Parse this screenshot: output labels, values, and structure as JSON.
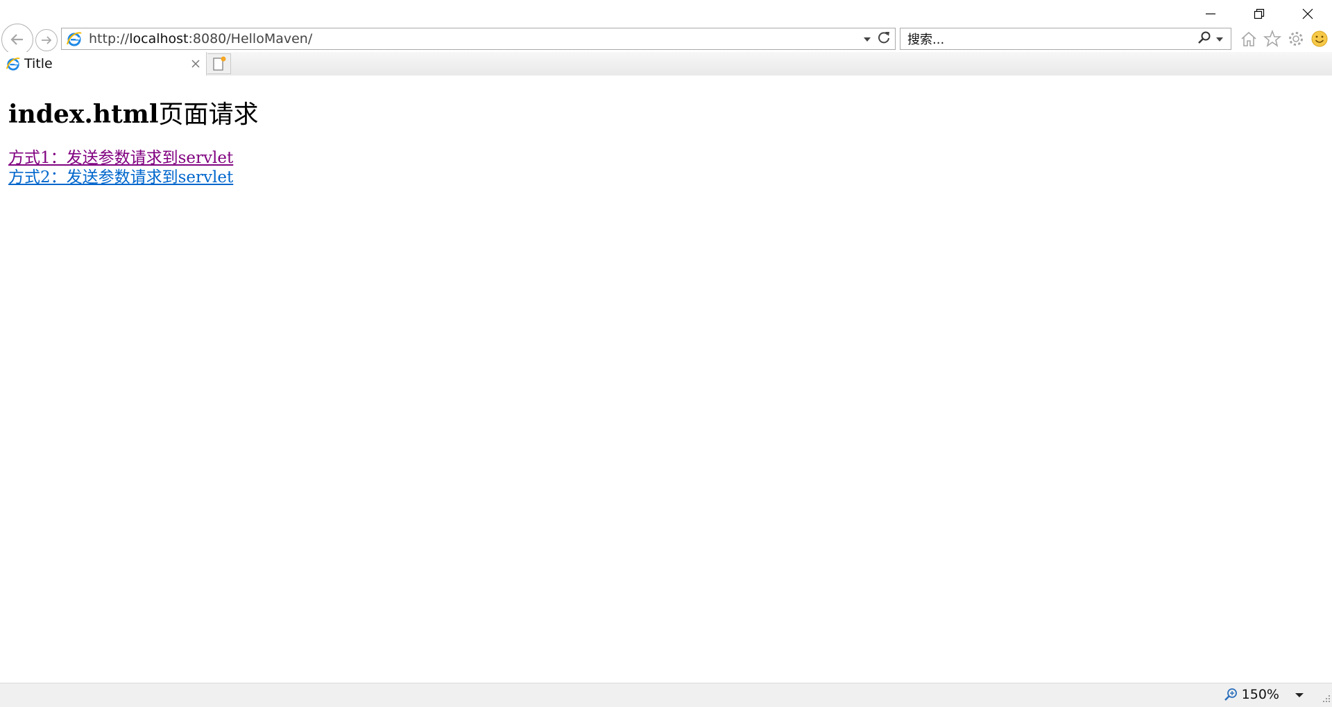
{
  "browser": {
    "address": {
      "protocol": "http://",
      "host": "localhost",
      "rest": ":8080/HelloMaven/"
    },
    "search": {
      "placeholder": "搜索..."
    },
    "tab": {
      "title": "Title"
    },
    "zoom": "150%",
    "icons": {
      "window": [
        "minimize-icon",
        "restore-icon",
        "close-icon"
      ],
      "nav": [
        "back-arrow-icon",
        "forward-arrow-icon"
      ],
      "address": [
        "ie-logo-icon",
        "dropdown-icon",
        "refresh-icon"
      ],
      "search": [
        "search-magnifier-icon",
        "dropdown-icon"
      ],
      "tools": [
        "home-icon",
        "star-icon",
        "gear-icon",
        "smiley-icon"
      ],
      "status": [
        "zoom-icon",
        "dropdown-icon",
        "resize-grip-icon"
      ]
    }
  },
  "page": {
    "heading_latin": "index.html",
    "heading_cjk": "页面请求",
    "links": [
      {
        "label": "方式1：发送参数请求到servlet",
        "visited": true
      },
      {
        "label": "方式2：发送参数请求到servlet",
        "visited": false
      }
    ]
  }
}
